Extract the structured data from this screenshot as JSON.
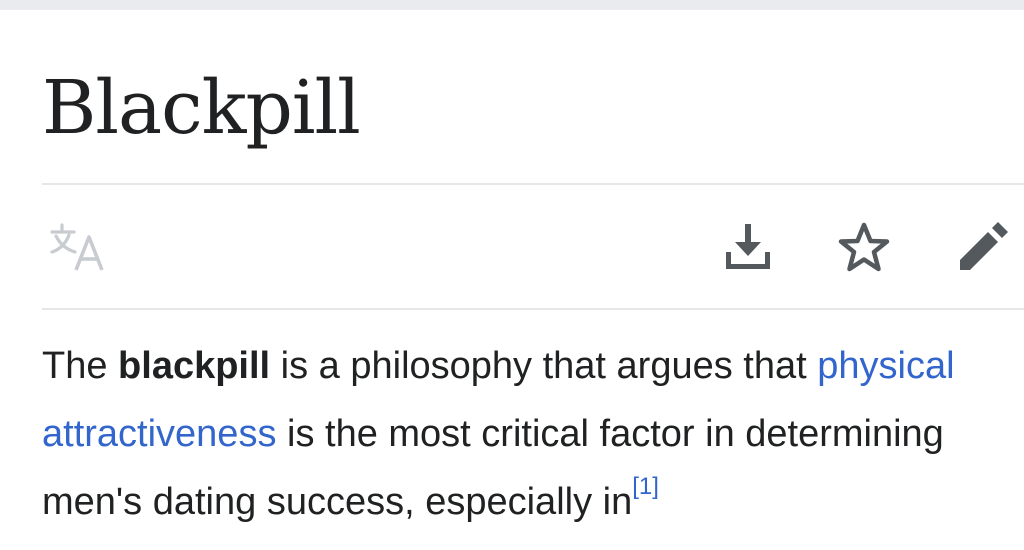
{
  "page": {
    "title": "Blackpill"
  },
  "toolbar": {
    "language_icon": "translate-icon",
    "download_icon": "download-icon",
    "watch_icon": "star-icon",
    "edit_icon": "pencil-icon"
  },
  "article": {
    "lead": {
      "part1": "The ",
      "term": "blackpill",
      "part2": " is a philosophy that argues that ",
      "link_text": "physical attractiveness",
      "part3": " is the most critical factor in determining men's dating success, especially in",
      "citation": "[1]"
    }
  },
  "colors": {
    "link": "#3366cc",
    "text": "#202122",
    "icon": "#54595d",
    "icon_disabled": "#c8ccd1"
  }
}
